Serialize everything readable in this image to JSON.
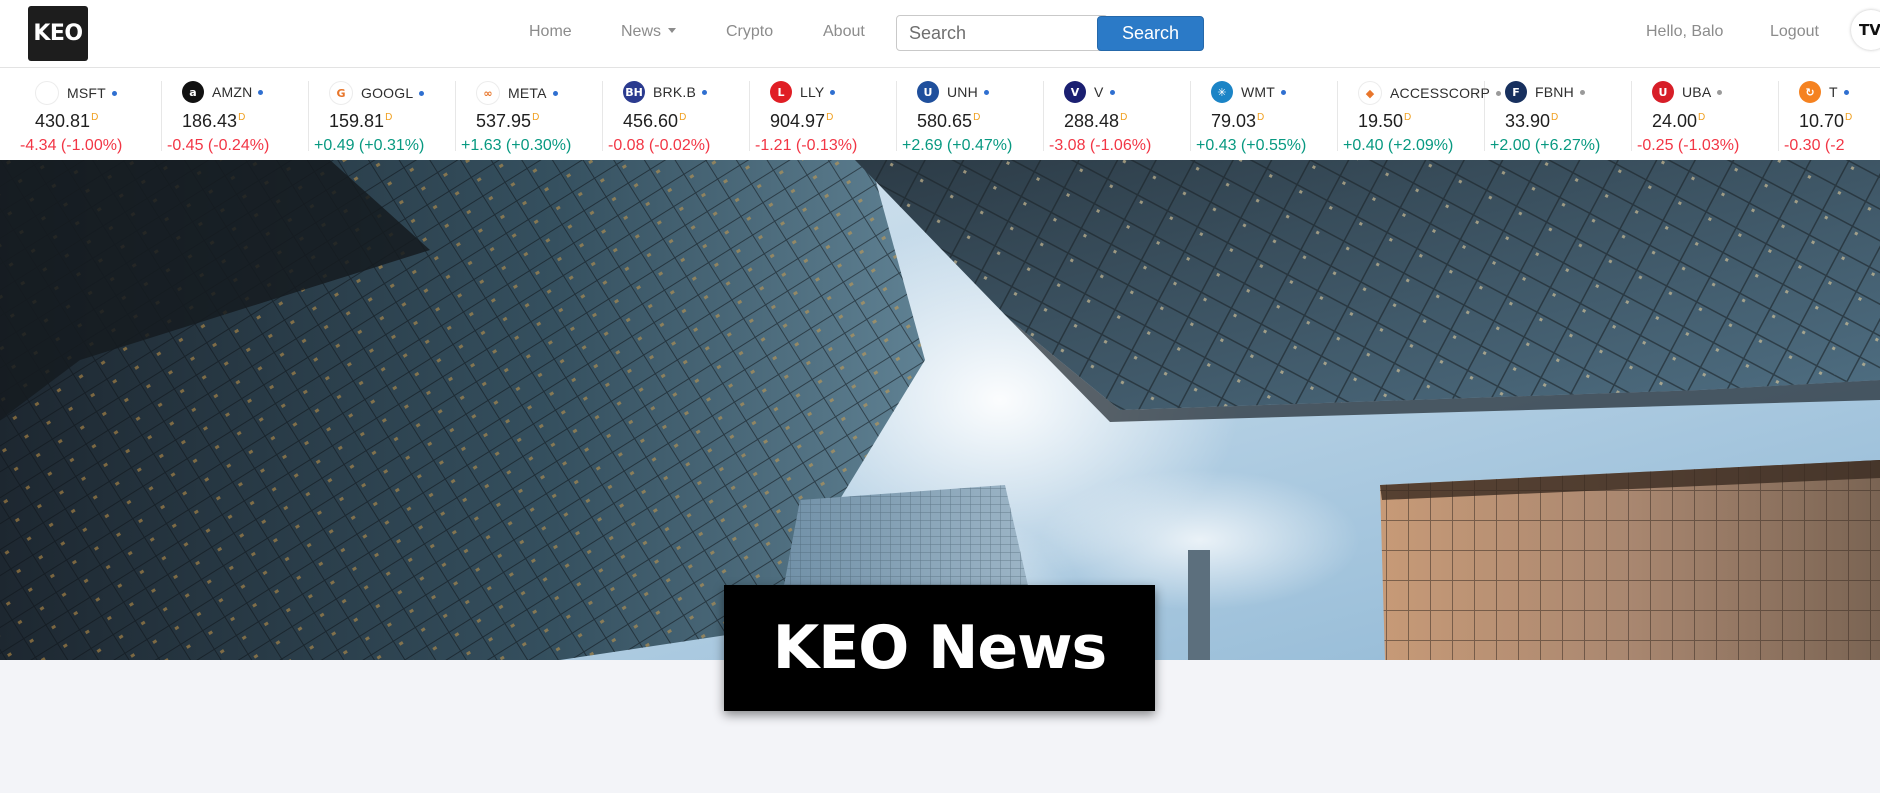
{
  "brand": {
    "logo_text": "KEO"
  },
  "nav": {
    "home": "Home",
    "news": "News",
    "crypto": "Crypto",
    "about": "About",
    "greeting": "Hello, Balo",
    "logout": "Logout"
  },
  "search": {
    "placeholder": "Search",
    "button_label": "Search"
  },
  "ticker": [
    {
      "symbol": "MSFT",
      "price": "430.81",
      "change": "-4.34 (-1.00%)",
      "direction": "down",
      "logo_color": "#ffffff",
      "logo_text": "",
      "icon": "microsoft-icon"
    },
    {
      "symbol": "AMZN",
      "price": "186.43",
      "change": "-0.45 (-0.24%)",
      "direction": "down",
      "logo_color": "#111111",
      "logo_text": "a",
      "icon": "amazon-icon"
    },
    {
      "symbol": "GOOGL",
      "price": "159.81",
      "change": "+0.49 (+0.31%)",
      "direction": "up",
      "logo_color": "#ffffff",
      "logo_text": "G",
      "icon": "google-icon"
    },
    {
      "symbol": "META",
      "price": "537.95",
      "change": "+1.63 (+0.30%)",
      "direction": "up",
      "logo_color": "#ffffff",
      "logo_text": "∞",
      "icon": "meta-icon"
    },
    {
      "symbol": "BRK.B",
      "price": "456.60",
      "change": "-0.08 (-0.02%)",
      "direction": "down",
      "logo_color": "#2b3b8f",
      "logo_text": "BH",
      "icon": "berkshire-icon"
    },
    {
      "symbol": "LLY",
      "price": "904.97",
      "change": "-1.21 (-0.13%)",
      "direction": "down",
      "logo_color": "#e01e25",
      "logo_text": "L",
      "icon": "lilly-icon"
    },
    {
      "symbol": "UNH",
      "price": "580.65",
      "change": "+2.69 (+0.47%)",
      "direction": "up",
      "logo_color": "#1f4f9c",
      "logo_text": "U",
      "icon": "unitedhealth-icon"
    },
    {
      "symbol": "V",
      "price": "288.48",
      "change": "-3.08 (-1.06%)",
      "direction": "down",
      "logo_color": "#1a1f71",
      "logo_text": "V",
      "icon": "visa-icon"
    },
    {
      "symbol": "WMT",
      "price": "79.03",
      "change": "+0.43 (+0.55%)",
      "direction": "up",
      "logo_color": "#1b84c6",
      "logo_text": "✳",
      "icon": "walmart-icon"
    },
    {
      "symbol": "ACCESSCORP",
      "price": "19.50",
      "change": "+0.40 (+2.09%)",
      "direction": "up",
      "logo_color": "#ffffff",
      "logo_text": "◆",
      "icon": "access-bank-icon"
    },
    {
      "symbol": "FBNH",
      "price": "33.90",
      "change": "+2.00 (+6.27%)",
      "direction": "up",
      "logo_color": "#17305e",
      "logo_text": "F",
      "icon": "fbnh-icon"
    },
    {
      "symbol": "UBA",
      "price": "24.00",
      "change": "-0.25 (-1.03%)",
      "direction": "down",
      "logo_color": "#d71e28",
      "logo_text": "U",
      "icon": "uba-icon"
    },
    {
      "symbol": "T",
      "price": "10.70",
      "change": "-0.30 (-2",
      "direction": "down",
      "logo_color": "#f58220",
      "logo_text": "↻",
      "icon": "transcorp-icon"
    }
  ],
  "ticker_badge": "TV",
  "colors": {
    "up": "#089981",
    "down": "#f23645",
    "accent": "#2b7ac7"
  },
  "hero": {
    "title": "KEO News"
  }
}
